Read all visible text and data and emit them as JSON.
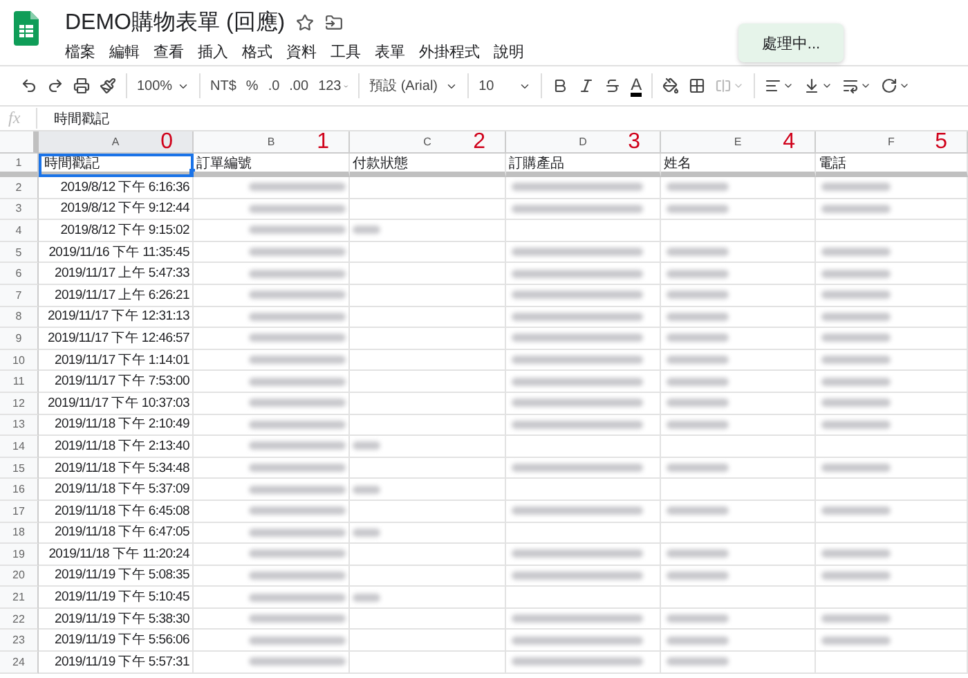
{
  "document": {
    "title": "DEMO購物表單 (回應)",
    "starred": false
  },
  "menu": [
    "檔案",
    "編輯",
    "查看",
    "插入",
    "格式",
    "資料",
    "工具",
    "表單",
    "外掛程式",
    "說明"
  ],
  "toast": "處理中...",
  "toolbar": [
    {
      "kind": "icon"
    },
    {
      "kind": "icon"
    },
    {
      "kind": "icon"
    },
    {
      "kind": "icon"
    },
    {
      "kind": "sep"
    },
    {
      "kind": "dropdown",
      "label": "100%"
    },
    {
      "kind": "sep"
    },
    {
      "kind": "text",
      "label": "NT$"
    },
    {
      "kind": "text",
      "label": "%"
    },
    {
      "kind": "text",
      "label": ".0"
    },
    {
      "kind": "text",
      "label": ".00"
    },
    {
      "kind": "dropdown",
      "label": "123"
    },
    {
      "kind": "sep"
    },
    {
      "kind": "wide-dropdown",
      "label": "預設 (Arial)"
    },
    {
      "kind": "sep"
    },
    {
      "kind": "wide-dropdown",
      "label": "10"
    },
    {
      "kind": "sep"
    },
    {
      "kind": "icon"
    },
    {
      "kind": "icon"
    },
    {
      "kind": "icon"
    },
    {
      "kind": "color-text",
      "label": "A"
    },
    {
      "kind": "sep"
    },
    {
      "kind": "icon"
    },
    {
      "kind": "icon"
    },
    {
      "kind": "icon",
      "disabled": true
    },
    {
      "kind": "sep"
    },
    {
      "kind": "icon"
    },
    {
      "kind": "icon"
    },
    {
      "kind": "icon"
    },
    {
      "kind": "icon"
    }
  ],
  "formula_bar": {
    "label": "fx",
    "value": "時間戳記"
  },
  "header_row_number": "1",
  "columns": [
    {
      "letter": "A",
      "annotation": "0",
      "header": "時間戳記",
      "selected": true
    },
    {
      "letter": "B",
      "annotation": "1",
      "header": "訂單編號",
      "selected": false
    },
    {
      "letter": "C",
      "annotation": "2",
      "header": "付款狀態",
      "selected": false
    },
    {
      "letter": "D",
      "annotation": "3",
      "header": "訂購產品",
      "selected": false
    },
    {
      "letter": "E",
      "annotation": "4",
      "header": "姓名",
      "selected": false
    },
    {
      "letter": "F",
      "annotation": "5",
      "header": "電話",
      "selected": false
    }
  ],
  "rows": [
    {
      "number": "2",
      "timestamp": "2019/8/12 下午 6:16:36",
      "blurred": [
        true,
        false,
        true,
        true,
        true
      ]
    },
    {
      "number": "3",
      "timestamp": "2019/8/12 下午 9:12:44",
      "blurred": [
        true,
        false,
        true,
        true,
        true
      ]
    },
    {
      "number": "4",
      "timestamp": "2019/8/12 下午 9:15:02",
      "blurred": [
        true,
        true,
        false,
        false,
        false
      ]
    },
    {
      "number": "5",
      "timestamp": "2019/11/16 下午 11:35:45",
      "blurred": [
        true,
        false,
        true,
        true,
        true
      ]
    },
    {
      "number": "6",
      "timestamp": "2019/11/17 上午 5:47:33",
      "blurred": [
        true,
        false,
        true,
        true,
        true
      ]
    },
    {
      "number": "7",
      "timestamp": "2019/11/17 上午 6:26:21",
      "blurred": [
        true,
        false,
        true,
        true,
        true
      ]
    },
    {
      "number": "8",
      "timestamp": "2019/11/17 下午 12:31:13",
      "blurred": [
        true,
        false,
        true,
        true,
        true
      ]
    },
    {
      "number": "9",
      "timestamp": "2019/11/17 下午 12:46:57",
      "blurred": [
        true,
        false,
        true,
        true,
        true
      ]
    },
    {
      "number": "10",
      "timestamp": "2019/11/17 下午 1:14:01",
      "blurred": [
        true,
        false,
        true,
        true,
        true
      ]
    },
    {
      "number": "11",
      "timestamp": "2019/11/17 下午 7:53:00",
      "blurred": [
        true,
        false,
        true,
        true,
        true
      ]
    },
    {
      "number": "12",
      "timestamp": "2019/11/17 下午 10:37:03",
      "blurred": [
        true,
        false,
        true,
        true,
        true
      ]
    },
    {
      "number": "13",
      "timestamp": "2019/11/18 下午 2:10:49",
      "blurred": [
        true,
        false,
        true,
        true,
        true
      ]
    },
    {
      "number": "14",
      "timestamp": "2019/11/18 下午 2:13:40",
      "blurred": [
        true,
        true,
        false,
        false,
        false
      ]
    },
    {
      "number": "15",
      "timestamp": "2019/11/18 下午 5:34:48",
      "blurred": [
        true,
        false,
        true,
        true,
        true
      ]
    },
    {
      "number": "16",
      "timestamp": "2019/11/18 下午 5:37:09",
      "blurred": [
        true,
        true,
        false,
        false,
        false
      ]
    },
    {
      "number": "17",
      "timestamp": "2019/11/18 下午 6:45:08",
      "blurred": [
        true,
        false,
        true,
        true,
        true
      ]
    },
    {
      "number": "18",
      "timestamp": "2019/11/18 下午 6:47:05",
      "blurred": [
        true,
        true,
        false,
        false,
        false
      ]
    },
    {
      "number": "19",
      "timestamp": "2019/11/18 下午 11:20:24",
      "blurred": [
        true,
        false,
        true,
        true,
        true
      ]
    },
    {
      "number": "20",
      "timestamp": "2019/11/19 下午 5:08:35",
      "blurred": [
        true,
        false,
        true,
        true,
        true
      ]
    },
    {
      "number": "21",
      "timestamp": "2019/11/19 下午 5:10:45",
      "blurred": [
        true,
        true,
        false,
        false,
        false
      ]
    },
    {
      "number": "22",
      "timestamp": "2019/11/19 下午 5:38:30",
      "blurred": [
        true,
        false,
        true,
        true,
        true
      ]
    },
    {
      "number": "23",
      "timestamp": "2019/11/19 下午 5:56:06",
      "blurred": [
        true,
        false,
        true,
        true,
        true
      ]
    },
    {
      "number": "24",
      "timestamp": "2019/11/19 下午 5:57:31",
      "blurred": [
        true,
        false,
        true,
        true,
        false
      ]
    }
  ]
}
